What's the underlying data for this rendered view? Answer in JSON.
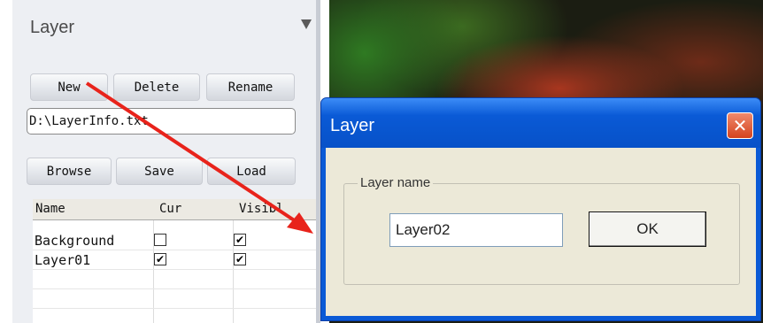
{
  "panel": {
    "title": "Layer",
    "collapse_icon": "triangle-down-icon",
    "buttons": {
      "new": "New",
      "delete": "Delete",
      "rename": "Rename",
      "browse": "Browse",
      "save": "Save",
      "load": "Load"
    },
    "path_value": "D:\\LayerInfo.txt",
    "table": {
      "headers": [
        "Name",
        "Cur",
        "Visibl"
      ],
      "rows": [
        {
          "name": "Background",
          "cur": false,
          "visible": true
        },
        {
          "name": "Layer01",
          "cur": true,
          "visible": true
        }
      ]
    }
  },
  "dialog": {
    "title": "Layer",
    "close_icon": "close-icon",
    "group_label": "Layer name",
    "name_value": "Layer02",
    "ok_label": "OK"
  },
  "annotation": {
    "color": "#e8231b",
    "icon": "red-arrow"
  },
  "colors": {
    "titlebar": "#0a5ad6",
    "close": "#d4431f",
    "panel": "#edeff3",
    "dialog_body": "#ece9d8"
  }
}
